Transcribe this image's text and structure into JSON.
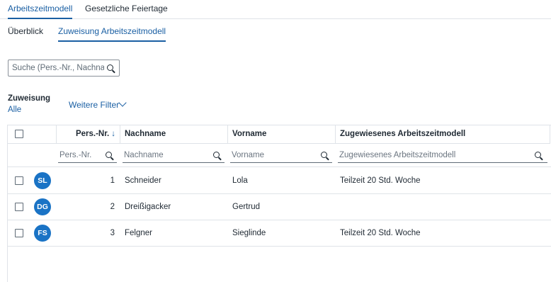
{
  "top_tabs": [
    {
      "label": "Arbeitszeitmodell",
      "active": true
    },
    {
      "label": "Gesetzliche Feiertage",
      "active": false
    }
  ],
  "sub_tabs": [
    {
      "label": "Überblick",
      "active": false
    },
    {
      "label": "Zuweisung Arbeitszeitmodell",
      "active": true
    }
  ],
  "search": {
    "placeholder": "Suche (Pers.-Nr., Nachna..."
  },
  "filters": {
    "assignment_label": "Zuweisung",
    "assignment_value": "Alle",
    "more_filters_label": "Weitere Filter"
  },
  "table": {
    "columns": {
      "pers_nr": "Pers.-Nr.",
      "sort_indicator": "↓",
      "nachname": "Nachname",
      "vorname": "Vorname",
      "modell": "Zugewiesenes Arbeitszeitmodell"
    },
    "filter_placeholders": {
      "pers_nr": "Pers.-Nr.",
      "nachname": "Nachname",
      "vorname": "Vorname",
      "modell": "Zugewiesenes Arbeitszeitmodell"
    },
    "rows": [
      {
        "initials": "SL",
        "pers_nr": "1",
        "nachname": "Schneider",
        "vorname": "Lola",
        "modell": "Teilzeit 20 Std. Woche"
      },
      {
        "initials": "DG",
        "pers_nr": "2",
        "nachname": "Dreißigacker",
        "vorname": "Gertrud",
        "modell": ""
      },
      {
        "initials": "FS",
        "pers_nr": "3",
        "nachname": "Felgner",
        "vorname": "Sieglinde",
        "modell": "Teilzeit 20 Std. Woche"
      }
    ]
  },
  "colors": {
    "accent": "#1a5fa3",
    "avatar": "#1a73c5",
    "border": "#dfe3e8"
  }
}
